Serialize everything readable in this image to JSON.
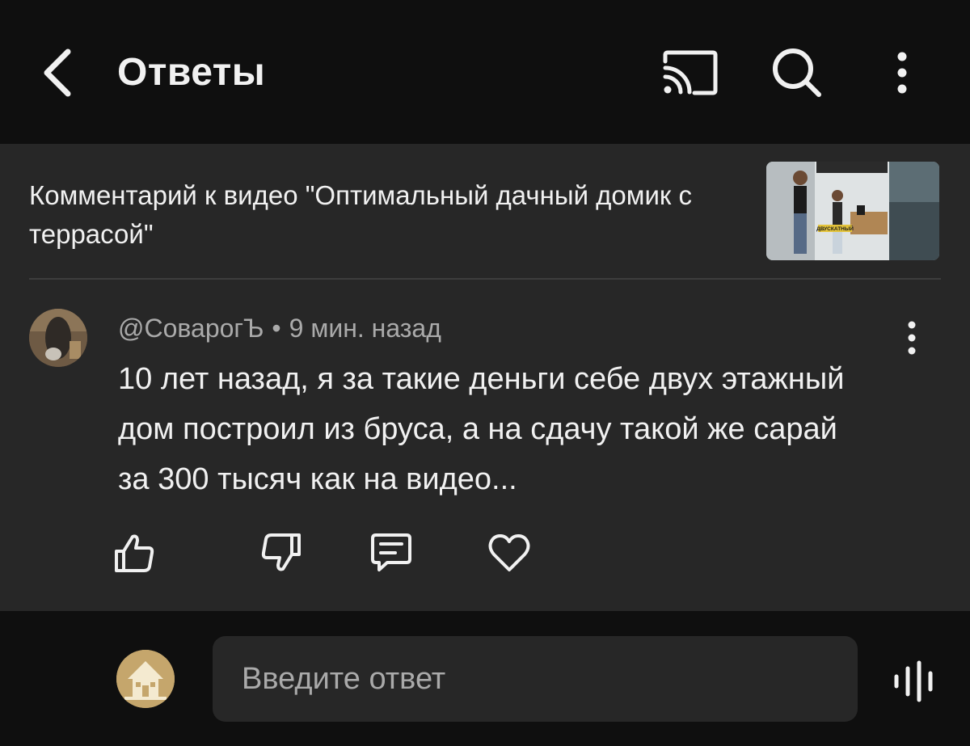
{
  "header": {
    "title": "Ответы",
    "back_icon": "chevron-left-icon",
    "cast_icon": "cast-icon",
    "search_icon": "search-icon",
    "more_icon": "more-vertical-icon"
  },
  "context": {
    "text": "Комментарий к видео \"Оптимальный дачный домик с террасой\"",
    "thumbnail_caption": "ДВУСКАТНЫЙ"
  },
  "comment": {
    "author": "@СоварогЪ",
    "separator": "•",
    "time": "9 мин. назад",
    "text": "10 лет назад, я за такие деньги себе двух этажный дом построил из бруса, а на сдачу такой же сарай за 300 тысяч как на видео...",
    "actions": {
      "like_icon": "thumb-up-icon",
      "dislike_icon": "thumb-down-icon",
      "reply_icon": "comment-icon",
      "heart_icon": "heart-icon"
    }
  },
  "reply": {
    "placeholder": "Введите ответ",
    "mic_icon": "voice-icon"
  },
  "colors": {
    "background": "#0f0f0f",
    "panel": "#272727",
    "text_primary": "#f1f1f1",
    "text_secondary": "#aaaaaa",
    "divider": "#3d3d3d"
  }
}
